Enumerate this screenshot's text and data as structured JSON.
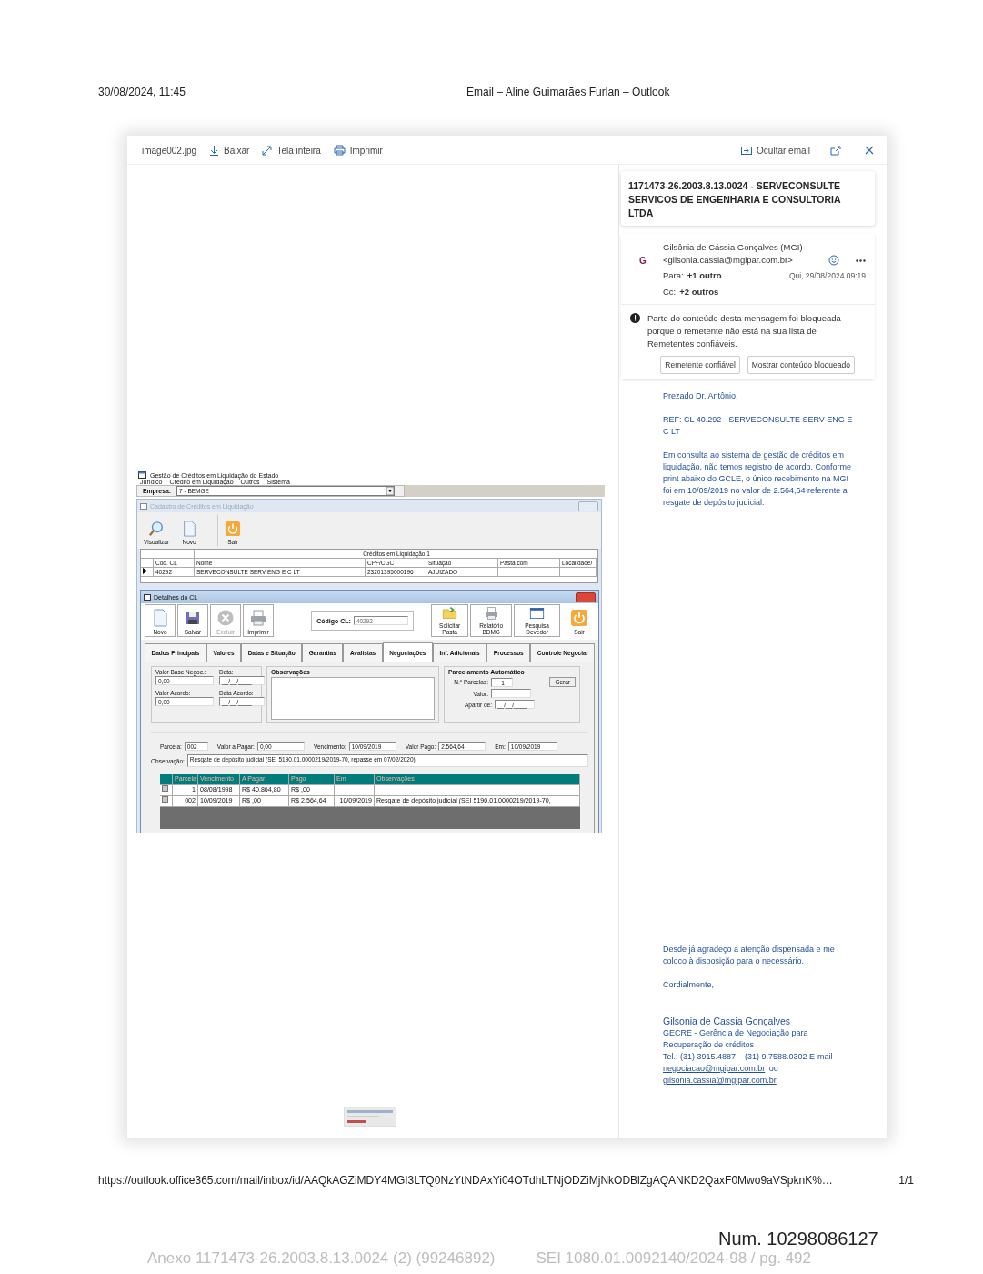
{
  "print_header": {
    "date": "30/08/2024, 11:45",
    "title": "Email – Aline Guimarães Furlan – Outlook"
  },
  "viewer": {
    "filename": "image002.jpg",
    "actions": [
      {
        "label": "Baixar",
        "kind": "download"
      },
      {
        "label": "Tela inteira",
        "kind": "fullscreen"
      },
      {
        "label": "Imprimir",
        "kind": "print"
      }
    ],
    "hide_label": "Ocultar email"
  },
  "app": {
    "title": "Gestão de Créditos em Liquidação do Estado",
    "menu": [
      "Jurídico",
      "Crédito em Liquidação",
      "Outros",
      "Sistema"
    ],
    "empresa_label": "Empresa:",
    "empresa_value": "7 - BEMGE",
    "list_window": {
      "title": "Cadastro de Créditos em Liquidação",
      "buttons": [
        {
          "label": "Visualizar",
          "kind": "search"
        },
        {
          "label": "Novo",
          "kind": "new"
        },
        {
          "label": "Sair",
          "kind": "exit"
        }
      ],
      "caption": "Créditos em Liquidação 1",
      "columns": [
        "Cód. CL",
        "Nome",
        "CPF/CGC",
        "Situação",
        "Pasta com",
        "Localidade/"
      ],
      "rows": [
        {
          "cells": [
            "40292",
            "SERVECONSULTE SERV ENG E C LT",
            "23201395000196",
            "AJUIZADO"
          ]
        }
      ]
    },
    "detail_window": {
      "title": "Detalhes do CL",
      "left_buttons": [
        {
          "label": "Novo",
          "kind": "new",
          "disabled": false
        },
        {
          "label": "Salvar",
          "kind": "save",
          "disabled": false
        },
        {
          "label": "Excluir",
          "kind": "delete",
          "disabled": true
        },
        {
          "label": "Imprimir",
          "kind": "print",
          "disabled": false
        }
      ],
      "code_label": "Código CL:",
      "code_value": "40292",
      "right_buttons": [
        {
          "label": "Solicitar Pasta",
          "kind": "folder"
        },
        {
          "label": "Relatório BDMG",
          "kind": "print"
        },
        {
          "label": "Pesquisa Devedor",
          "kind": "window"
        }
      ],
      "exit_button": {
        "label": "Sair",
        "kind": "exit"
      },
      "tabs": [
        {
          "label": "Dados Principais",
          "selected": false
        },
        {
          "label": "Valores",
          "selected": false
        },
        {
          "label": "Datas e Situação",
          "selected": false
        },
        {
          "label": "Garantias",
          "selected": false
        },
        {
          "label": "Avalistas",
          "selected": false
        },
        {
          "label": "Negociações",
          "selected": true
        },
        {
          "label": "Inf. Adicionais",
          "selected": false
        },
        {
          "label": "Processos",
          "selected": false
        },
        {
          "label": "Controle Negocial",
          "selected": false
        }
      ],
      "base_fields": [
        {
          "label": "Valor Base Negoc.:",
          "value": "0,00"
        },
        {
          "label": "Data:",
          "value": "__/__/____"
        },
        {
          "label": "Valor Acordo:",
          "value": "0,00"
        },
        {
          "label": "Data Acordo:",
          "value": "__/__/____"
        }
      ],
      "notes_group": "Observações",
      "auto_group": {
        "title": "Parcelamento Automático",
        "fields": [
          {
            "label": "N.º Parcelas:",
            "value": "1"
          },
          {
            "label": "Valor:"
          },
          {
            "label": "Apartir de:",
            "value": "__/__/____"
          }
        ],
        "button": "Gerar"
      },
      "installment_fields": [
        {
          "label": "Parcela:",
          "value": "002"
        },
        {
          "label": "Valor a Pagar:",
          "value": "0,00"
        },
        {
          "label": "Vencimento:",
          "value": "10/09/2019"
        },
        {
          "label": "Valor Pago:",
          "value": "2.564,64"
        },
        {
          "label": "Em:",
          "value": "10/09/2019"
        }
      ],
      "note_label": "Observação:",
      "note_value": "Resgate de depósito judicial (SEI 5190.01.0000219/2019-70, repasse em 07/02/2020)",
      "table": {
        "columns": [
          "Parcela",
          "Vencimento",
          "A Pagar",
          "Pago",
          "Em",
          "Observações"
        ],
        "rows": [
          {
            "cells": [
              "1",
              "08/08/1998",
              "R$ 40.864,80",
              "R$ ,00"
            ]
          },
          {
            "cells": [
              "002",
              "10/09/2019",
              "R$ ,00",
              "R$ 2.564,64",
              "10/09/2019",
              "Resgate de depósito judicial (SEI 5190.01.0000219/2019-70,"
            ]
          }
        ]
      }
    }
  },
  "email": {
    "subject": "1171473-26.2003.8.13.0024 - SERVECONSULTE SERVICOS DE ENGENHARIA E CONSULTORIA LTDA",
    "avatar": "G",
    "sender_name": "Gilsônia de Cássia Gonçalves (MGI)",
    "sender_email": "<gilsonia.cassia@mgipar.com.br>",
    "to_label": "Para:",
    "to_value": "+1 outro",
    "date": "Qui, 29/08/2024 09:19",
    "cc_label": "Cc:",
    "cc_value": "+2 outros",
    "warning": "Parte do conteúdo desta mensagem foi bloqueada porque o remetente não está na sua lista de Remetentes confiáveis.",
    "warning_buttons": [
      "Remetente confiável",
      "Mostrar conteúdo bloqueado"
    ],
    "body_top": [
      "Prezado Dr. Antônio,",
      "REF: CL 40.292 - SERVECONSULTE SERV ENG E C LT",
      "Em consulta ao sistema de gestão de créditos em liquidação, não temos registro de acordo. Conforme print abaixo do GCLE, o único recebimento na MGI foi em 10/09/2019 no valor de 2.564,64 referente a resgate de depósito judicial."
    ],
    "body_bottom": [
      "Desde já agradeço a atenção dispensada e me coloco à disposição para o necessário.",
      "Cordialmente,"
    ],
    "signature": {
      "name": "Gilsonia de Cassia Gonçalves",
      "lines": [
        "GECRE - Gerência de Negociação para Recuperação de créditos",
        "Tel.: (31) 3915.4887 – (31) 9.7588.0302  E-mail"
      ],
      "link_1": "negociacao@mgipar.com.br",
      "joiner": "ou",
      "link_2": "gilsonia.cassia@mgipar.com.br"
    }
  },
  "print_footer": {
    "url": "https://outlook.office365.com/mail/inbox/id/AAQkAGZiMDY4MGI3LTQ0NzYtNDAxYi04OTdhLTNjODZiMjNkODBlZgAQANKD2QaxF0Mwo9aVSpknK%…",
    "page": "1/1",
    "num": "Num. 10298086127",
    "stamp_left": "Anexo 1171473-26.2003.8.13.0024 (2) (99246892)",
    "stamp_right": "SEI 1080.01.0092140/2024-98 / pg. 492"
  }
}
